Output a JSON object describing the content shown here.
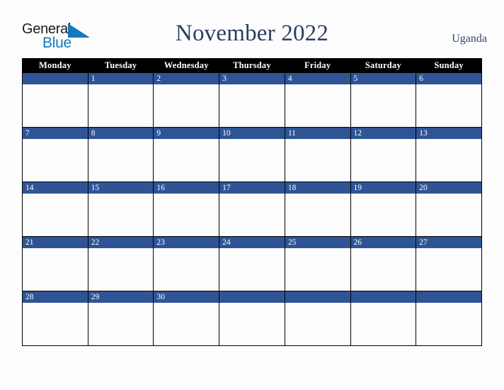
{
  "brand": {
    "name_part1": "General",
    "name_part2": "Blue",
    "triangle_icon": "triangle-icon",
    "color_dark": "#1b1b1b",
    "color_blue": "#1278bf",
    "triangle_color": "#1278bf"
  },
  "header": {
    "title": "November 2022",
    "country": "Uganda",
    "title_color": "#2c3d63",
    "country_color": "#33466e"
  },
  "calendar": {
    "month": "November",
    "year": "2022",
    "weekday_headers": [
      "Monday",
      "Tuesday",
      "Wednesday",
      "Thursday",
      "Friday",
      "Saturday",
      "Sunday"
    ],
    "header_bg": "#000000",
    "header_text_color": "#ffffff",
    "date_bar_color": "#2f5496",
    "date_text_color": "#ffffff",
    "cell_bg": "#fdfdfd",
    "grid_line_color": "#000000",
    "weeks": [
      [
        {
          "day": "",
          "events": []
        },
        {
          "day": "1",
          "events": []
        },
        {
          "day": "2",
          "events": []
        },
        {
          "day": "3",
          "events": []
        },
        {
          "day": "4",
          "events": []
        },
        {
          "day": "5",
          "events": []
        },
        {
          "day": "6",
          "events": []
        }
      ],
      [
        {
          "day": "7",
          "events": []
        },
        {
          "day": "8",
          "events": []
        },
        {
          "day": "9",
          "events": []
        },
        {
          "day": "10",
          "events": []
        },
        {
          "day": "11",
          "events": []
        },
        {
          "day": "12",
          "events": []
        },
        {
          "day": "13",
          "events": []
        }
      ],
      [
        {
          "day": "14",
          "events": []
        },
        {
          "day": "15",
          "events": []
        },
        {
          "day": "16",
          "events": []
        },
        {
          "day": "17",
          "events": []
        },
        {
          "day": "18",
          "events": []
        },
        {
          "day": "19",
          "events": []
        },
        {
          "day": "20",
          "events": []
        }
      ],
      [
        {
          "day": "21",
          "events": []
        },
        {
          "day": "22",
          "events": []
        },
        {
          "day": "23",
          "events": []
        },
        {
          "day": "24",
          "events": []
        },
        {
          "day": "25",
          "events": []
        },
        {
          "day": "26",
          "events": []
        },
        {
          "day": "27",
          "events": []
        }
      ],
      [
        {
          "day": "28",
          "events": []
        },
        {
          "day": "29",
          "events": []
        },
        {
          "day": "30",
          "events": []
        },
        {
          "day": "",
          "events": []
        },
        {
          "day": "",
          "events": []
        },
        {
          "day": "",
          "events": []
        },
        {
          "day": "",
          "events": []
        }
      ]
    ]
  }
}
